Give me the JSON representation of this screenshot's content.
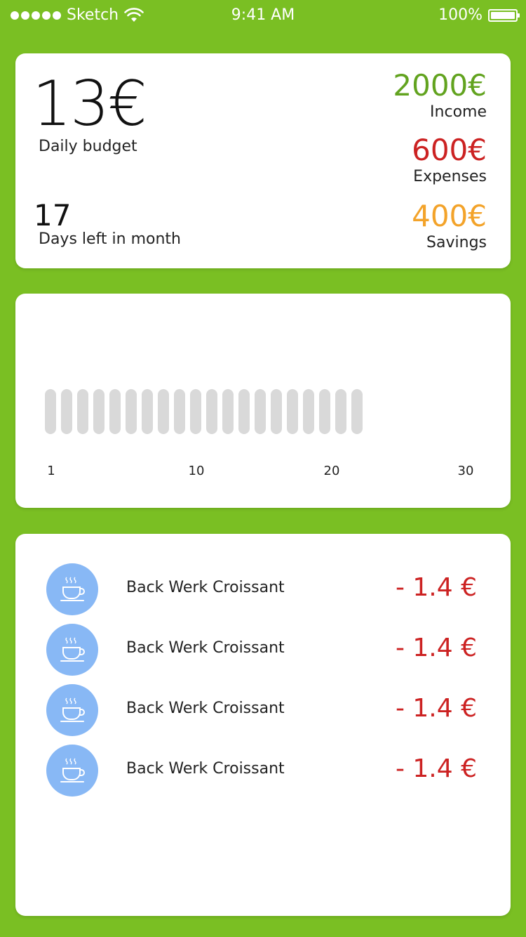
{
  "status_bar": {
    "carrier": "Sketch",
    "time": "9:41 AM",
    "battery": "100%",
    "battery_level": 1.0,
    "signal_bars": 5
  },
  "colors": {
    "background": "#7abf23",
    "income": "#62a31f",
    "expenses": "#cc2222",
    "savings": "#f3a32a",
    "avatar": "#88b8f5",
    "bar": "#d9d9d9"
  },
  "summary": {
    "daily_budget_value": "13€",
    "daily_budget_label": "Daily budget",
    "days_left_value": "17",
    "days_left_label": "Days left in month",
    "income": {
      "value": "2000€",
      "label": "Income"
    },
    "expenses": {
      "value": "600€",
      "label": "Expenses"
    },
    "savings": {
      "value": "400€",
      "label": "Savings"
    }
  },
  "daily_chart": {
    "bar_count": 20,
    "day_range": [
      1,
      30
    ],
    "tick_labels": [
      "1",
      "10",
      "20",
      "30"
    ]
  },
  "transactions": [
    {
      "icon": "coffee-cup-icon",
      "name": "Back Werk Croissant",
      "amount": "- 1.4 €"
    },
    {
      "icon": "coffee-cup-icon",
      "name": "Back Werk Croissant",
      "amount": "- 1.4 €"
    },
    {
      "icon": "coffee-cup-icon",
      "name": "Back Werk Croissant",
      "amount": "- 1.4 €"
    },
    {
      "icon": "coffee-cup-icon",
      "name": "Back Werk Croissant",
      "amount": "- 1.4 €"
    }
  ]
}
